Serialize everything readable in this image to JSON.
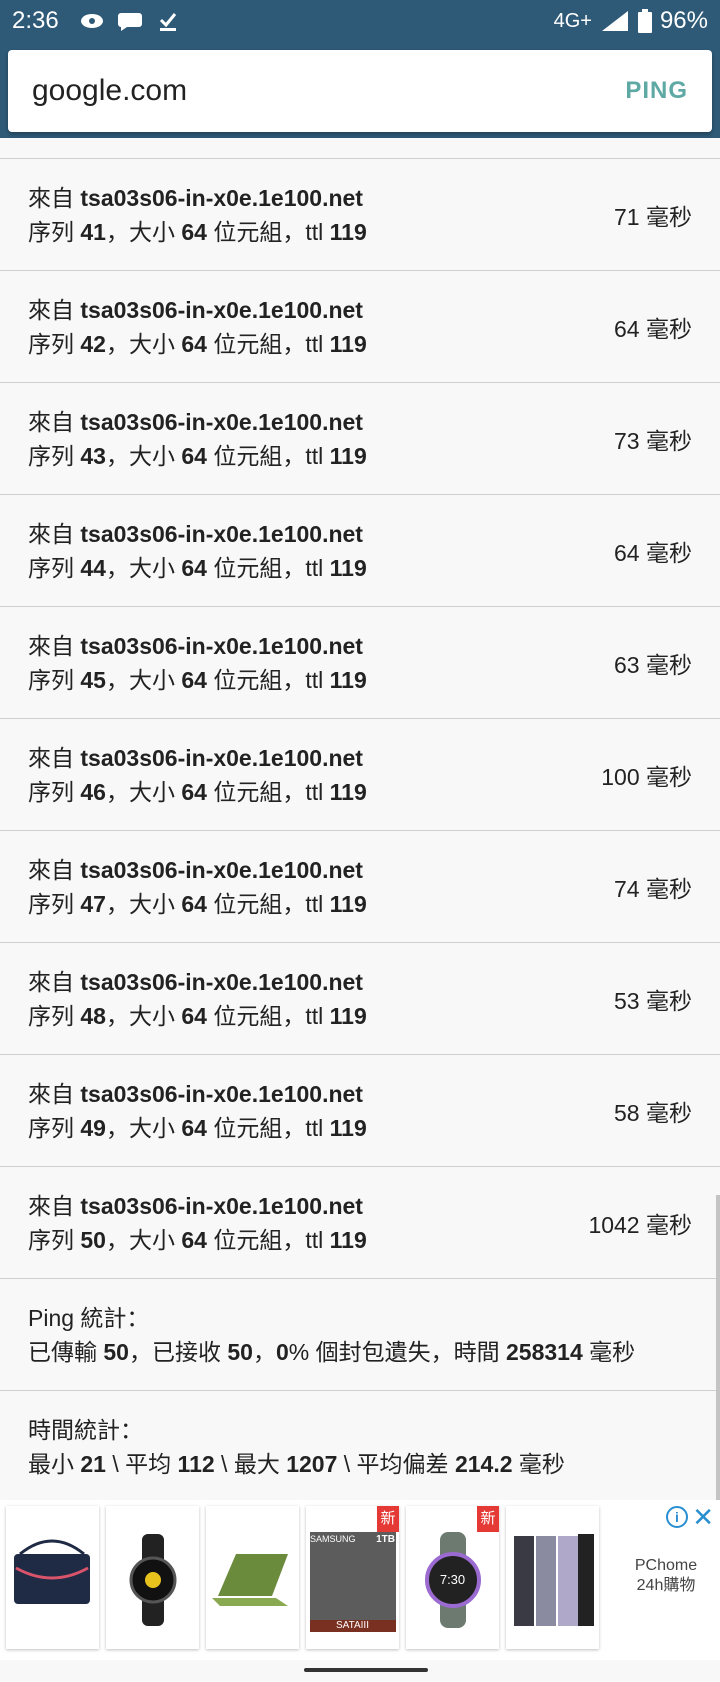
{
  "status_bar": {
    "time": "2:36",
    "network": "4G+",
    "battery": "96%"
  },
  "search": {
    "host": "google.com",
    "ping_label": "PING"
  },
  "replies": [
    {
      "from_label": "來自",
      "host": "tsa03s06-in-x0e.1e100.net",
      "seq_label": "序列",
      "seq": "41",
      "size_label": "，大小",
      "size": "64",
      "unit_label": "位元組，ttl",
      "ttl": "119",
      "rtt": "71 毫秒"
    },
    {
      "from_label": "來自",
      "host": "tsa03s06-in-x0e.1e100.net",
      "seq_label": "序列",
      "seq": "42",
      "size_label": "，大小",
      "size": "64",
      "unit_label": "位元組，ttl",
      "ttl": "119",
      "rtt": "64 毫秒"
    },
    {
      "from_label": "來自",
      "host": "tsa03s06-in-x0e.1e100.net",
      "seq_label": "序列",
      "seq": "43",
      "size_label": "，大小",
      "size": "64",
      "unit_label": "位元組，ttl",
      "ttl": "119",
      "rtt": "73 毫秒"
    },
    {
      "from_label": "來自",
      "host": "tsa03s06-in-x0e.1e100.net",
      "seq_label": "序列",
      "seq": "44",
      "size_label": "，大小",
      "size": "64",
      "unit_label": "位元組，ttl",
      "ttl": "119",
      "rtt": "64 毫秒"
    },
    {
      "from_label": "來自",
      "host": "tsa03s06-in-x0e.1e100.net",
      "seq_label": "序列",
      "seq": "45",
      "size_label": "，大小",
      "size": "64",
      "unit_label": "位元組，ttl",
      "ttl": "119",
      "rtt": "63 毫秒"
    },
    {
      "from_label": "來自",
      "host": "tsa03s06-in-x0e.1e100.net",
      "seq_label": "序列",
      "seq": "46",
      "size_label": "，大小",
      "size": "64",
      "unit_label": "位元組，ttl",
      "ttl": "119",
      "rtt": "100 毫秒"
    },
    {
      "from_label": "來自",
      "host": "tsa03s06-in-x0e.1e100.net",
      "seq_label": "序列",
      "seq": "47",
      "size_label": "，大小",
      "size": "64",
      "unit_label": "位元組，ttl",
      "ttl": "119",
      "rtt": "74 毫秒"
    },
    {
      "from_label": "來自",
      "host": "tsa03s06-in-x0e.1e100.net",
      "seq_label": "序列",
      "seq": "48",
      "size_label": "，大小",
      "size": "64",
      "unit_label": "位元組，ttl",
      "ttl": "119",
      "rtt": "53 毫秒"
    },
    {
      "from_label": "來自",
      "host": "tsa03s06-in-x0e.1e100.net",
      "seq_label": "序列",
      "seq": "49",
      "size_label": "，大小",
      "size": "64",
      "unit_label": "位元組，ttl",
      "ttl": "119",
      "rtt": "58 毫秒"
    },
    {
      "from_label": "來自",
      "host": "tsa03s06-in-x0e.1e100.net",
      "seq_label": "序列",
      "seq": "50",
      "size_label": "，大小",
      "size": "64",
      "unit_label": "位元組，ttl",
      "ttl": "119",
      "rtt": "1042 毫秒"
    }
  ],
  "ping_stats": {
    "title": "Ping 統計：",
    "sent_label": "已傳輸",
    "sent": "50",
    "recv_label": "，已接收",
    "recv": "50",
    "sep": "，",
    "loss": "0",
    "loss_label": "% 個封包遺失，時間",
    "time": "258314",
    "unit": "毫秒"
  },
  "time_stats": {
    "title": "時間統計：",
    "min_label": "最小",
    "min": "21",
    "avg_label": "\\ 平均",
    "avg": "112",
    "max_label": "\\ 最大",
    "max": "1207",
    "mdev_label": "\\ 平均偏差",
    "mdev": "214.2",
    "unit": "毫秒"
  },
  "ad": {
    "new_tag": "新",
    "ssd_brand": "SAMSUNG",
    "ssd_capacity": "1TB",
    "ssd_interface": "SATAIII",
    "watch_time": "7:30",
    "brand_line1": "PChome",
    "brand_line2": "24h購物"
  },
  "colors": {
    "header": "#2e5a78",
    "ping_accent": "#5fa9a4",
    "divider": "#cfcfcf",
    "ad_tag": "#e53935",
    "ad_icon": "#2a8fd1"
  }
}
